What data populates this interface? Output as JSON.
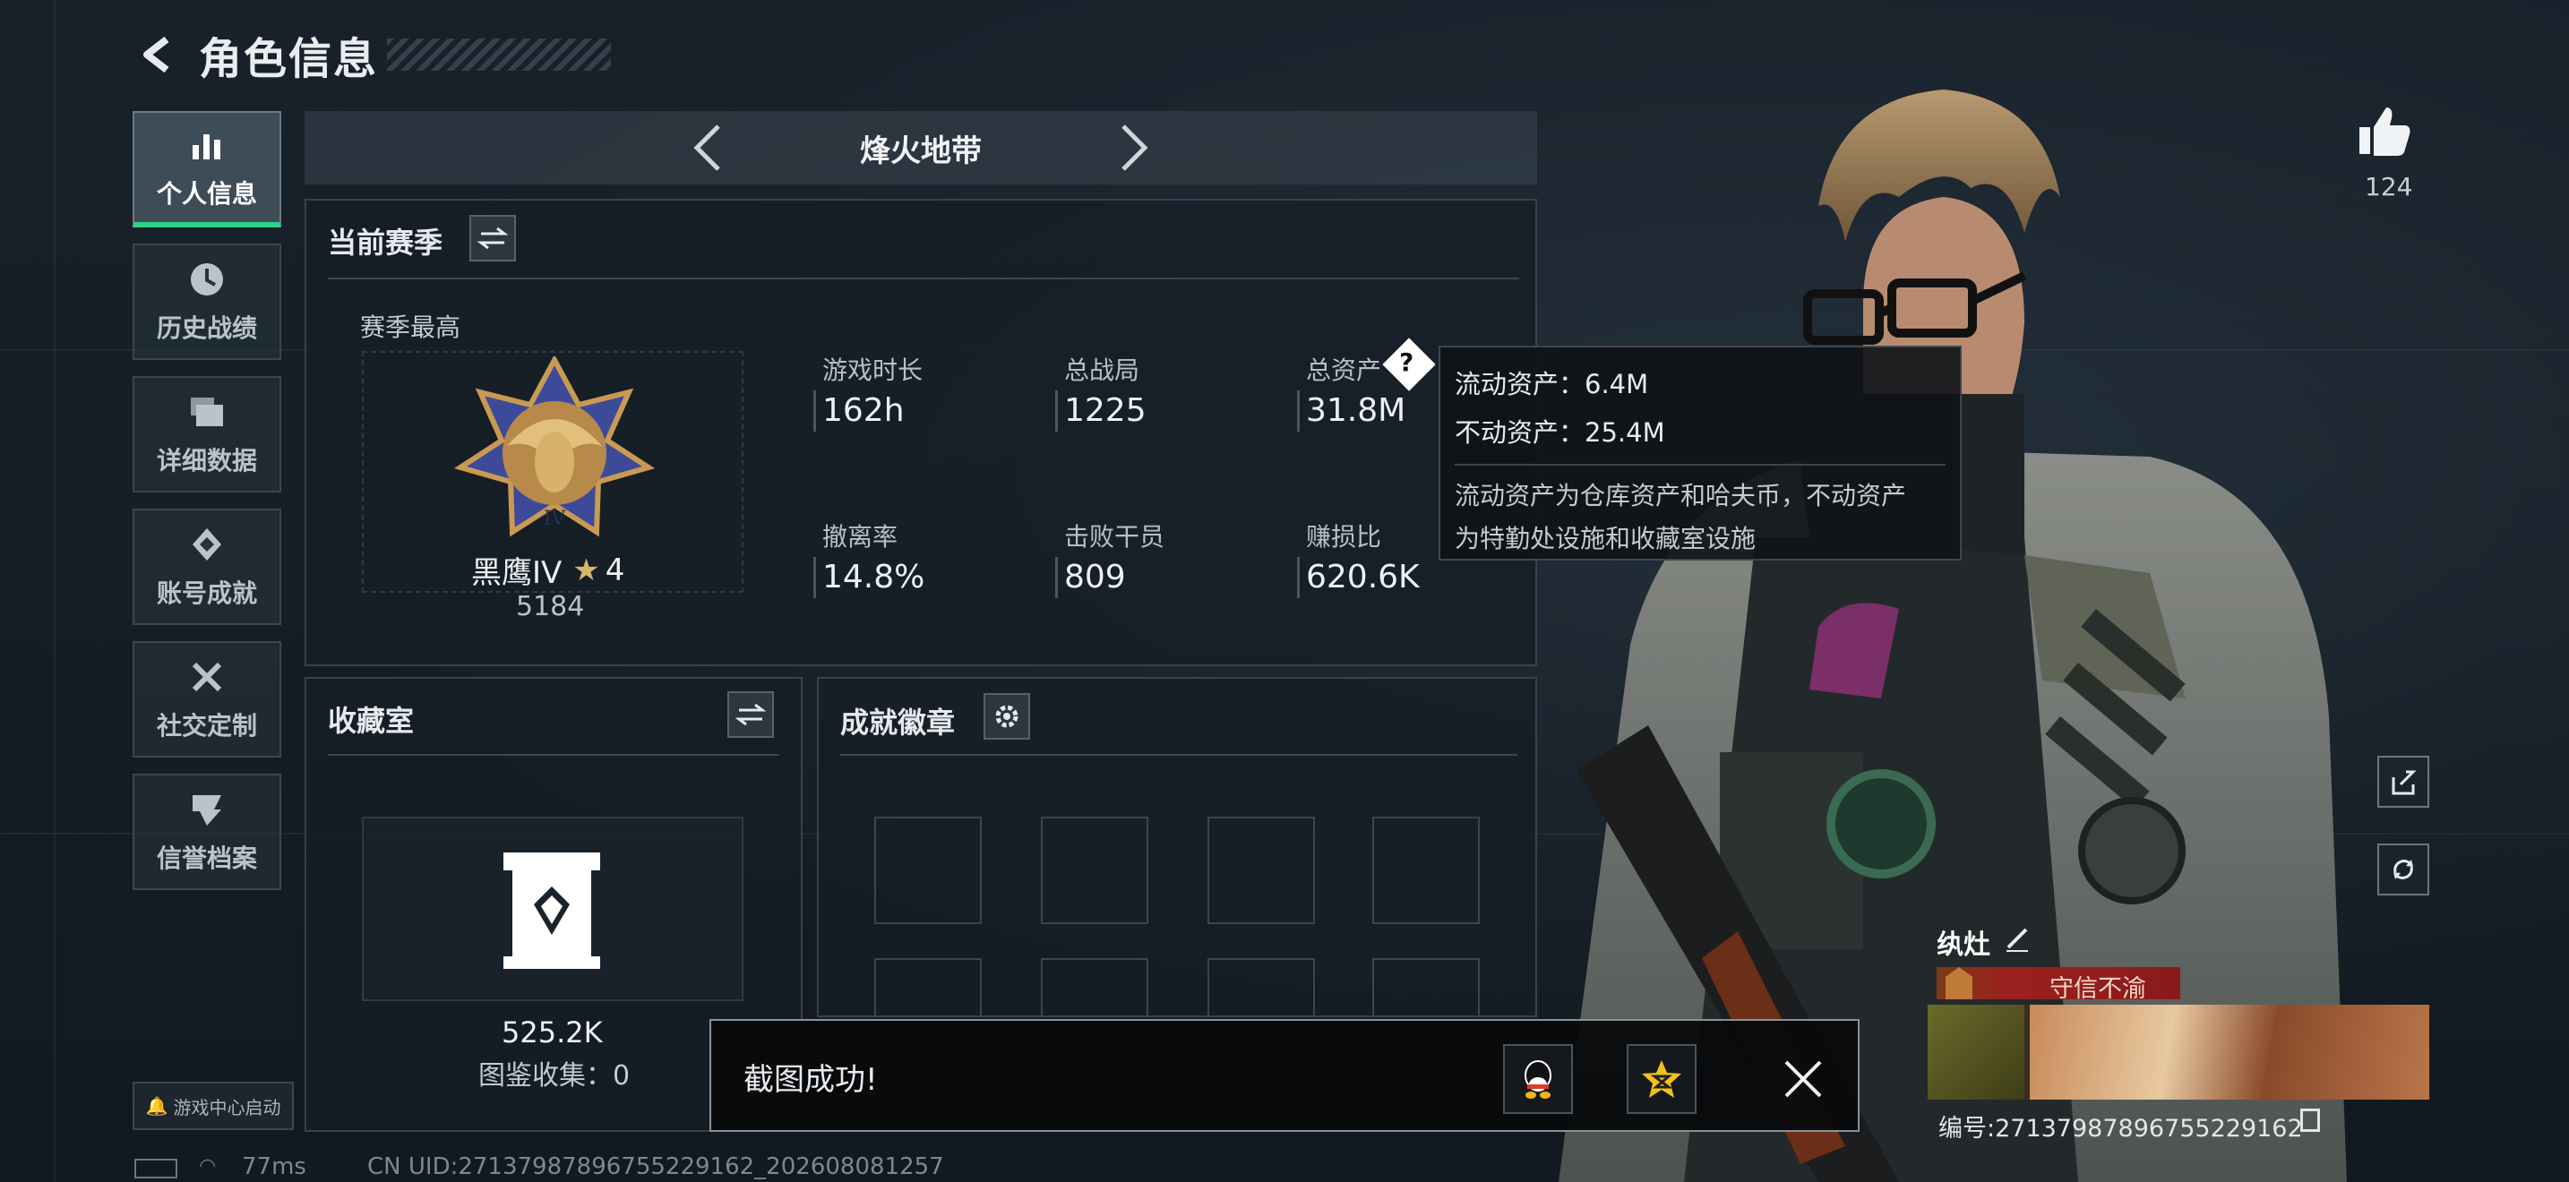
{
  "header": {
    "title": "角色信息"
  },
  "sidebar": {
    "items": [
      {
        "label": "个人信息",
        "icon": "bar-chart-icon",
        "active": true
      },
      {
        "label": "历史战绩",
        "icon": "history-icon",
        "active": false
      },
      {
        "label": "详细数据",
        "icon": "folder-icon",
        "active": false
      },
      {
        "label": "账号成就",
        "icon": "achievement-icon",
        "active": false
      },
      {
        "label": "社交定制",
        "icon": "tools-icon",
        "active": false
      },
      {
        "label": "信誉档案",
        "icon": "reputation-icon",
        "active": false
      }
    ],
    "game_center_label": "游戏中心启动"
  },
  "mode": {
    "name": "烽火地带"
  },
  "season": {
    "title": "当前赛季",
    "best_label": "赛季最高",
    "rank_name": "黑鹰IV",
    "rank_stars": "4",
    "rank_score": "5184",
    "stats": [
      {
        "label": "游戏时长",
        "value": "162h"
      },
      {
        "label": "总战局",
        "value": "1225"
      },
      {
        "label": "总资产",
        "value": "31.8M"
      },
      {
        "label": "撤离率",
        "value": "14.8%"
      },
      {
        "label": "击败干员",
        "value": "809"
      },
      {
        "label": "赚损比",
        "value": "620.6K"
      }
    ]
  },
  "tooltip": {
    "liquid": "流动资产：6.4M",
    "fixed": "不动资产：25.4M",
    "desc_line1": "流动资产为仓库资产和哈夫币，不动资产",
    "desc_line2": "为特勤处设施和收藏室设施"
  },
  "collection": {
    "title": "收藏室",
    "value": "525.2K",
    "collected": "图鉴收集：0"
  },
  "badges": {
    "title": "成就徽章"
  },
  "toast": {
    "message": "截图成功!"
  },
  "profile": {
    "likes": "124",
    "nickname": "纨灶",
    "rank_title": "守信不渝",
    "uid_text": "编号:27137987896755229162"
  },
  "status_bar": {
    "ping": "77ms",
    "cn_uid": "CN UID:27137987896755229162_202608081257"
  },
  "colors": {
    "accent_green": "#2fd08a",
    "badge_red": "#9c2020"
  }
}
